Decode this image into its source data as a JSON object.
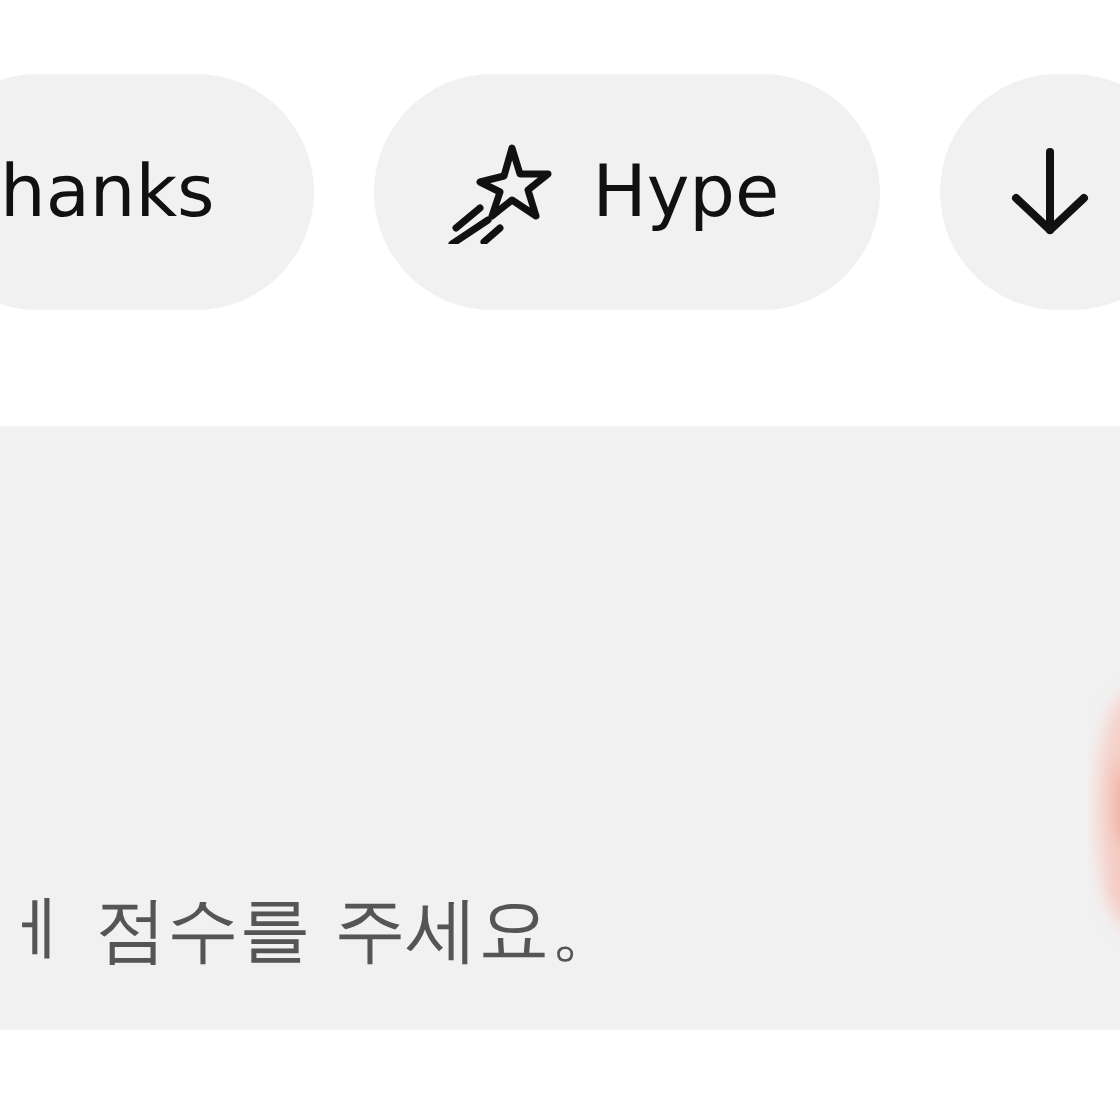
{
  "chips": [
    {
      "kind": "text",
      "label": "hanks"
    },
    {
      "kind": "hype",
      "label": "Hype"
    },
    {
      "kind": "download"
    }
  ],
  "panel": {
    "text": "ㅔ 점수를 주세요。"
  }
}
